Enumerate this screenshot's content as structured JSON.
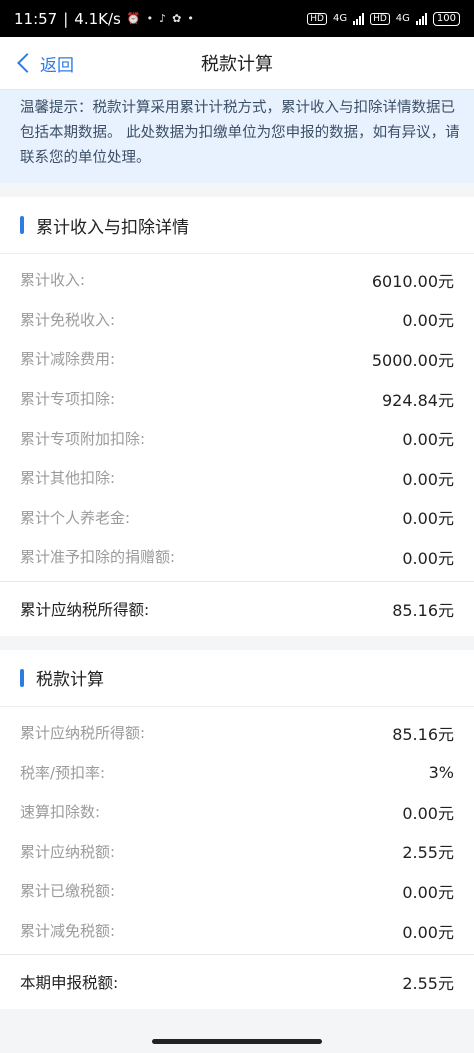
{
  "status_bar": {
    "time": "11:57",
    "speed": "4.1K/s",
    "net1": "4G",
    "net2": "4G",
    "battery": "100"
  },
  "nav": {
    "back_label": "返回",
    "title": "税款计算"
  },
  "notice": {
    "text": "温馨提示：税款计算采用累计计税方式，累计收入与扣除详情数据已包括本期数据。 此处数据为扣缴单位为您申报的数据，如有异议，请联系您的单位处理。"
  },
  "income_section": {
    "title": "累计收入与扣除详情",
    "rows": [
      {
        "label": "累计收入:",
        "value": "6010.00元"
      },
      {
        "label": "累计免税收入:",
        "value": "0.00元"
      },
      {
        "label": "累计减除费用:",
        "value": "5000.00元"
      },
      {
        "label": "累计专项扣除:",
        "value": "924.84元"
      },
      {
        "label": "累计专项附加扣除:",
        "value": "0.00元"
      },
      {
        "label": "累计其他扣除:",
        "value": "0.00元"
      },
      {
        "label": "累计个人养老金:",
        "value": "0.00元"
      },
      {
        "label": "累计准予扣除的捐赠额:",
        "value": "0.00元"
      }
    ],
    "total": {
      "label": "累计应纳税所得额:",
      "value": "85.16元"
    }
  },
  "tax_section": {
    "title": "税款计算",
    "rows": [
      {
        "label": "累计应纳税所得额:",
        "value": "85.16元"
      },
      {
        "label": "税率/预扣率:",
        "value": "3%"
      },
      {
        "label": "速算扣除数:",
        "value": "0.00元"
      },
      {
        "label": "累计应纳税额:",
        "value": "2.55元"
      },
      {
        "label": "累计已缴税额:",
        "value": "0.00元"
      },
      {
        "label": "累计减免税额:",
        "value": "0.00元"
      }
    ],
    "total": {
      "label": "本期申报税额:",
      "value": "2.55元"
    }
  }
}
